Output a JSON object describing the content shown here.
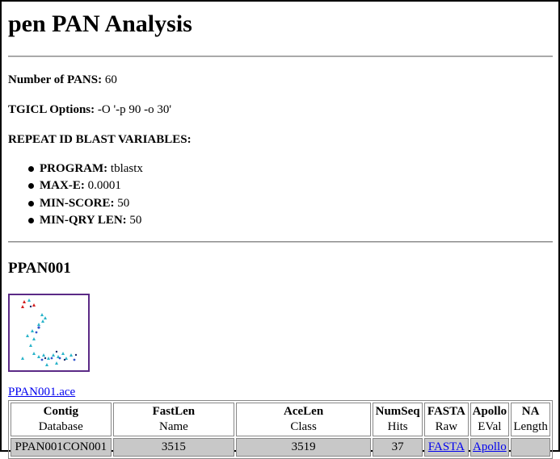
{
  "page": {
    "title": "pen PAN Analysis"
  },
  "summary": {
    "num_pans_label": "Number of PANS:",
    "num_pans_value": "60",
    "tgicl_label": "TGICL Options:",
    "tgicl_value": "-O '-p 90 -o 30'",
    "repeat_heading": "REPEAT ID BLAST VARIABLES:"
  },
  "blast_vars": [
    {
      "label": "PROGRAM:",
      "value": "tblastx"
    },
    {
      "label": "MAX-E:",
      "value": "0.0001"
    },
    {
      "label": "MIN-SCORE:",
      "value": "50"
    },
    {
      "label": "MIN-QRY LEN:",
      "value": "50"
    }
  ],
  "section": {
    "title": "PPAN001",
    "ace_link": "PPAN001.ace"
  },
  "table": {
    "headers": [
      {
        "top": "Contig",
        "bottom": "Database"
      },
      {
        "top": "FastLen",
        "bottom": "Name"
      },
      {
        "top": "AceLen",
        "bottom": "Class"
      },
      {
        "top": "NumSeq",
        "bottom": "Hits"
      },
      {
        "top": "FASTA",
        "bottom": "Raw"
      },
      {
        "top": "Apollo",
        "bottom": "EVal"
      },
      {
        "top": "NA",
        "bottom": "Length"
      }
    ],
    "row": {
      "contig": "PPAN001CON001",
      "fastlen": "3515",
      "acelen": "3519",
      "numseq": "37",
      "fasta": "FASTA",
      "apollo": "Apollo",
      "na": ""
    }
  },
  "thumbnail_colors": {
    "border": "#5b2a86",
    "cyan": "#29b3c9",
    "red": "#d21e1e",
    "blue": "#3355cc",
    "navy": "#1a2a6c"
  }
}
